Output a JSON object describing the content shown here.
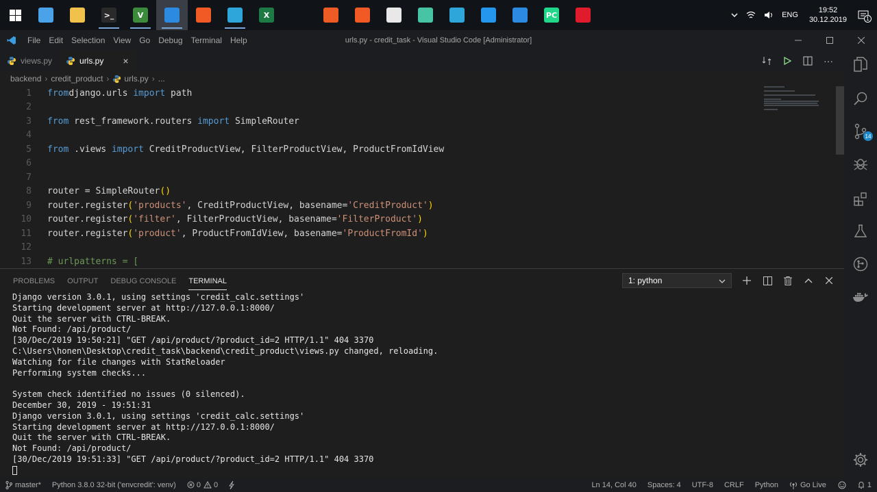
{
  "taskbar": {
    "apps_left": [
      {
        "name": "pc-icon",
        "glyph": "",
        "color": "#4aa3e8",
        "running": false
      },
      {
        "name": "file-explorer-icon",
        "glyph": "",
        "color": "#f0c24b",
        "running": false
      },
      {
        "name": "terminal-icon",
        "glyph": ">_",
        "color": "#2a2a2a",
        "running": true
      },
      {
        "name": "vim-icon",
        "glyph": "V",
        "color": "#3c8a3c",
        "running": true
      },
      {
        "name": "vscode-icon",
        "glyph": "",
        "color": "#2c8be0",
        "running": true,
        "active": true
      },
      {
        "name": "brave-icon",
        "glyph": "",
        "color": "#f15a24",
        "running": false
      },
      {
        "name": "telegram-icon",
        "glyph": "",
        "color": "#2ea6da",
        "running": true
      },
      {
        "name": "excel-icon",
        "glyph": "X",
        "color": "#1e7a45",
        "running": false
      }
    ],
    "apps_mid": [
      {
        "name": "postman-icon",
        "glyph": "",
        "color": "#ef5b25"
      },
      {
        "name": "brave-icon",
        "glyph": "",
        "color": "#f15a24"
      },
      {
        "name": "document-icon",
        "glyph": "",
        "color": "#e8e8e8"
      },
      {
        "name": "electron-icon",
        "glyph": "",
        "color": "#47c4a3"
      },
      {
        "name": "telegram-icon",
        "glyph": "",
        "color": "#2ea6da"
      },
      {
        "name": "docker-icon",
        "glyph": "",
        "color": "#2496ed"
      },
      {
        "name": "vscode-icon",
        "glyph": "",
        "color": "#2c8be0"
      },
      {
        "name": "pycharm-icon",
        "glyph": "PC",
        "color": "#21d789"
      },
      {
        "name": "opera-icon",
        "glyph": "",
        "color": "#e01b2c"
      }
    ],
    "lang": "ENG",
    "time": "19:52",
    "date": "30.12.2019",
    "notifications": "1"
  },
  "titlebar": {
    "menu": [
      "File",
      "Edit",
      "Selection",
      "View",
      "Go",
      "Debug",
      "Terminal",
      "Help"
    ],
    "title": "urls.py - credit_task - Visual Studio Code [Administrator]"
  },
  "tabs": [
    {
      "label": "views.py",
      "active": false
    },
    {
      "label": "urls.py",
      "active": true
    }
  ],
  "breadcrumb": {
    "parts": [
      "backend",
      "credit_product",
      "urls.py",
      "..."
    ]
  },
  "editor": {
    "lines": [
      {
        "n": "1",
        "tokens": [
          [
            "kw",
            "from"
          ],
          [
            "",
            "django.urls "
          ],
          [
            "kw",
            "import"
          ],
          [
            "",
            " path"
          ]
        ]
      },
      {
        "n": "2",
        "tokens": []
      },
      {
        "n": "3",
        "tokens": [
          [
            "kw",
            "from"
          ],
          [
            "",
            " rest_framework.routers "
          ],
          [
            "kw",
            "import"
          ],
          [
            "",
            " SimpleRouter"
          ]
        ]
      },
      {
        "n": "4",
        "tokens": []
      },
      {
        "n": "5",
        "tokens": [
          [
            "kw",
            "from"
          ],
          [
            "",
            " .views "
          ],
          [
            "kw",
            "import"
          ],
          [
            "",
            " CreditProductView, FilterProductView, ProductFromIdView"
          ]
        ]
      },
      {
        "n": "6",
        "tokens": []
      },
      {
        "n": "7",
        "tokens": []
      },
      {
        "n": "8",
        "tokens": [
          [
            "",
            "router = SimpleRouter"
          ],
          [
            "brk",
            "()"
          ]
        ]
      },
      {
        "n": "9",
        "tokens": [
          [
            "",
            "router.register"
          ],
          [
            "brk",
            "("
          ],
          [
            "str",
            "'products'"
          ],
          [
            "",
            ", CreditProductView, basename="
          ],
          [
            "str",
            "'CreditProduct'"
          ],
          [
            "brk",
            ")"
          ]
        ]
      },
      {
        "n": "10",
        "tokens": [
          [
            "",
            "router.register"
          ],
          [
            "brk",
            "("
          ],
          [
            "str",
            "'filter'"
          ],
          [
            "",
            ", FilterProductView, basename="
          ],
          [
            "str",
            "'FilterProduct'"
          ],
          [
            "brk",
            ")"
          ]
        ]
      },
      {
        "n": "11",
        "tokens": [
          [
            "",
            "router.register"
          ],
          [
            "brk",
            "("
          ],
          [
            "str",
            "'product'"
          ],
          [
            "",
            ", ProductFromIdView, basename="
          ],
          [
            "str",
            "'ProductFromId'"
          ],
          [
            "brk",
            ")"
          ]
        ]
      },
      {
        "n": "12",
        "tokens": []
      },
      {
        "n": "13",
        "tokens": [
          [
            "cmt",
            "# urlpatterns = ["
          ]
        ]
      }
    ]
  },
  "panel": {
    "tabs": [
      "PROBLEMS",
      "OUTPUT",
      "DEBUG CONSOLE",
      "TERMINAL"
    ],
    "active_tab": "TERMINAL",
    "terminal_select": "1: python",
    "terminal_lines": [
      "Django version 3.0.1, using settings 'credit_calc.settings'",
      "Starting development server at http://127.0.0.1:8000/",
      "Quit the server with CTRL-BREAK.",
      "Not Found: /api/product/",
      "[30/Dec/2019 19:50:21] \"GET /api/product/?product_id=2 HTTP/1.1\" 404 3370",
      "C:\\Users\\honen\\Desktop\\credit_task\\backend\\credit_product\\views.py changed, reloading.",
      "Watching for file changes with StatReloader",
      "Performing system checks...",
      "",
      "System check identified no issues (0 silenced).",
      "December 30, 2019 - 19:51:31",
      "Django version 3.0.1, using settings 'credit_calc.settings'",
      "Starting development server at http://127.0.0.1:8000/",
      "Quit the server with CTRL-BREAK.",
      "Not Found: /api/product/",
      "[30/Dec/2019 19:51:33] \"GET /api/product/?product_id=2 HTTP/1.1\" 404 3370"
    ]
  },
  "activitybar": {
    "scm_badge": "14"
  },
  "statusbar": {
    "branch": "master*",
    "interpreter": "Python 3.8.0 32-bit ('envcredit': venv)",
    "errors": "0",
    "warnings": "0",
    "position": "Ln 14, Col 40",
    "spaces": "Spaces: 4",
    "encoding": "UTF-8",
    "eol": "CRLF",
    "language": "Python",
    "golive": "Go Live",
    "notifications": "1"
  }
}
